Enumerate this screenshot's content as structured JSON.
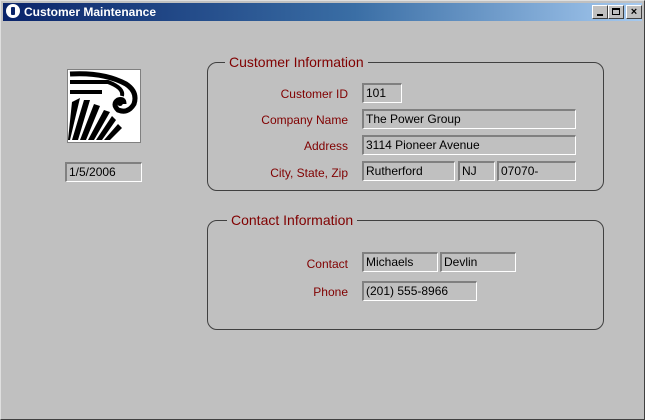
{
  "window": {
    "title": "Customer Maintenance",
    "controls": {
      "minimize": "_",
      "maximize": "□",
      "close": "×"
    }
  },
  "date_value": "1/5/2006",
  "logo": {
    "icon": "ionic-column-icon"
  },
  "customer_info": {
    "legend": "Customer Information",
    "customer_id_label": "Customer ID",
    "customer_id": "101",
    "company_name_label": "Company Name",
    "company_name": "The Power Group",
    "address_label": "Address",
    "address": "3114 Pioneer Avenue",
    "city_state_zip_label": "City, State, Zip",
    "city": "Rutherford",
    "state": "NJ",
    "zip": "07070-"
  },
  "contact_info": {
    "legend": "Contact Information",
    "contact_label": "Contact",
    "last_name": "Michaels",
    "first_name": "Devlin",
    "phone_label": "Phone",
    "phone": "(201) 555-8966"
  },
  "colors": {
    "label": "#800000",
    "background": "#c0c0c0",
    "title_start": "#0a246a",
    "title_end": "#a6caf0"
  }
}
